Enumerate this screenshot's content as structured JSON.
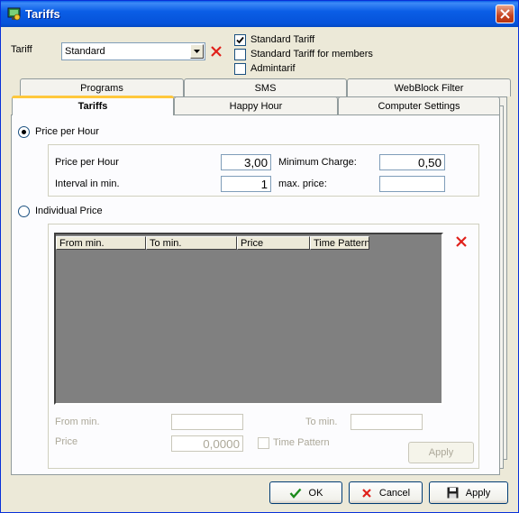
{
  "window": {
    "title": "Tariffs"
  },
  "tariff": {
    "label": "Tariff",
    "selected": "Standard",
    "checkboxes": [
      {
        "label": "Standard Tariff",
        "checked": true
      },
      {
        "label": "Standard Tariff for members",
        "checked": false
      },
      {
        "label": "Admintarif",
        "checked": false
      }
    ]
  },
  "tabs": {
    "row_back": [
      "Programs",
      "SMS",
      "WebBlock Filter"
    ],
    "row_front": [
      "Tariffs",
      "Happy Hour",
      "Computer Settings"
    ],
    "active": "Tariffs"
  },
  "price_per_hour": {
    "radio_label": "Price per Hour",
    "selected": true,
    "price_label": "Price per Hour",
    "price_value": "3,00",
    "interval_label": "Interval in min.",
    "interval_value": "1",
    "min_charge_label": "Minimum Charge:",
    "min_charge_value": "0,50",
    "max_price_label": "max. price:",
    "max_price_value": ""
  },
  "individual_price": {
    "radio_label": "Individual Price",
    "selected": false,
    "columns": [
      "From min.",
      "To min.",
      "Price",
      "Time Pattern"
    ],
    "from_label": "From min.",
    "from_value": "",
    "to_label": "To min.",
    "to_value": "",
    "price_label": "Price",
    "price_value": "0,0000",
    "time_pattern_label": "Time Pattern",
    "apply_label": "Apply"
  },
  "footer": {
    "ok_label": "OK",
    "cancel_label": "Cancel",
    "apply_label": "Apply"
  },
  "colors": {
    "accent_red": "#e0201a",
    "ok_green": "#1a8a1a",
    "title_blue": "#0552d9"
  }
}
